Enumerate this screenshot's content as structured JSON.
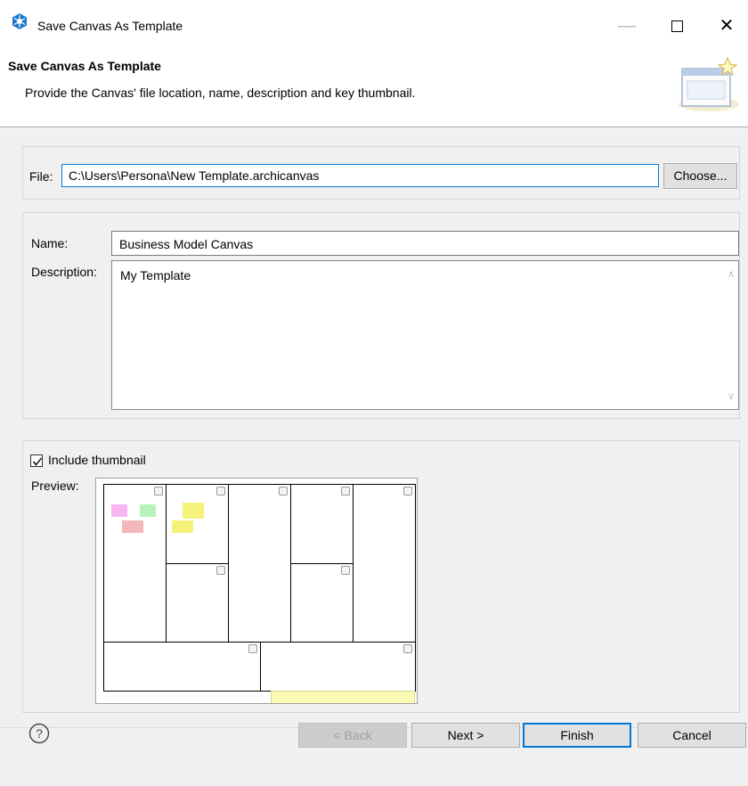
{
  "window": {
    "title": "Save Canvas As Template",
    "minimize_glyph": "—",
    "close_glyph": "✕"
  },
  "header": {
    "title": "Save Canvas As Template",
    "description": "Provide the Canvas' file location, name, description and key thumbnail."
  },
  "file": {
    "label": "File:",
    "value": "C:\\Users\\Persona\\New Template.archicanvas",
    "choose_label": "Choose..."
  },
  "details": {
    "name_label": "Name:",
    "name_value": "Business Model Canvas",
    "description_label": "Description:",
    "description_value": "My Template"
  },
  "thumbnail": {
    "include_label": "Include thumbnail",
    "include_checked": true,
    "preview_label": "Preview:"
  },
  "buttons": {
    "help_icon": "?",
    "back": "< Back",
    "next": "Next >",
    "finish": "Finish",
    "cancel": "Cancel"
  },
  "colors": {
    "accent": "#0078d7",
    "app_icon": "#1e78c8"
  }
}
